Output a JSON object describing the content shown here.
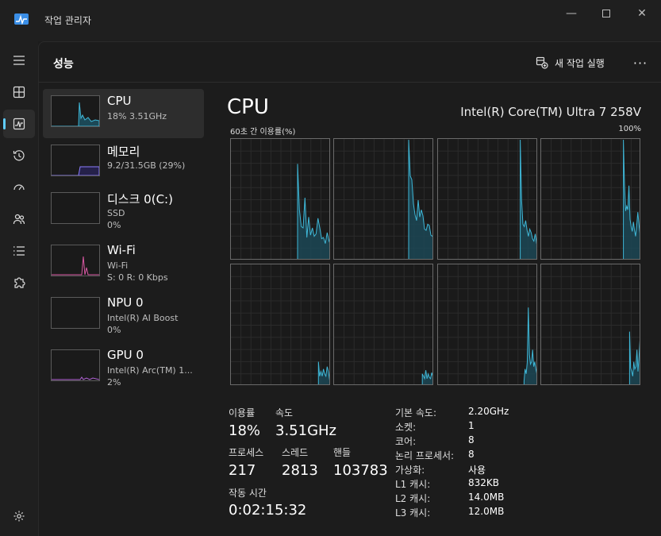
{
  "window": {
    "title": "작업 관리자"
  },
  "header": {
    "title": "성능",
    "new_task_label": "새 작업 실행",
    "more_label": "···"
  },
  "devices": [
    {
      "name": "CPU",
      "line1": "18% 3.51GHz",
      "line2": ""
    },
    {
      "name": "메모리",
      "line1": "9.2/31.5GB (29%)",
      "line2": ""
    },
    {
      "name": "디스크 0(C:)",
      "line1": "SSD",
      "line2": "0%"
    },
    {
      "name": "Wi-Fi",
      "line1": "Wi-Fi",
      "line2": "S: 0  R: 0 Kbps"
    },
    {
      "name": "NPU 0",
      "line1": "Intel(R) AI Boost",
      "line2": "0%"
    },
    {
      "name": "GPU 0",
      "line1": "Intel(R) Arc(TM) 1...",
      "line2": "2%"
    }
  ],
  "detail": {
    "title": "CPU",
    "model": "Intel(R) Core(TM) Ultra 7 258V",
    "graph_label_left": "60초 간 이용률(%)",
    "graph_label_right": "100%"
  },
  "stats": {
    "utilization_label": "이용률",
    "utilization_value": "18%",
    "speed_label": "속도",
    "speed_value": "3.51GHz",
    "processes_label": "프로세스",
    "processes_value": "217",
    "threads_label": "스레드",
    "threads_value": "2813",
    "handles_label": "핸들",
    "handles_value": "103783",
    "uptime_label": "작동 시간",
    "uptime_value": "0:02:15:32"
  },
  "specs": [
    {
      "key": "기본 속도:",
      "value": "2.20GHz"
    },
    {
      "key": "소켓:",
      "value": "1"
    },
    {
      "key": "코어:",
      "value": "8"
    },
    {
      "key": "논리 프로세서:",
      "value": "8"
    },
    {
      "key": "가상화:",
      "value": "사용"
    },
    {
      "key": "L1 캐시:",
      "value": "832KB"
    },
    {
      "key": "L2 캐시:",
      "value": "14.0MB"
    },
    {
      "key": "L3 캐시:",
      "value": "12.0MB"
    }
  ],
  "colors": {
    "cpu_line": "#3fb8d8",
    "cpu_fill": "#1c4856",
    "memory_line": "#8b7cff",
    "wifi_line": "#d958a4",
    "gpu_line": "#b163d6",
    "accent": "#60cdff"
  },
  "chart_data": {
    "type": "area",
    "y_range": [
      0,
      100
    ],
    "x_range_seconds": 60,
    "cores": [
      [
        0,
        0,
        0,
        0,
        0,
        0,
        0,
        0,
        0,
        0,
        0,
        0,
        0,
        0,
        0,
        0,
        0,
        0,
        0,
        0,
        0,
        0,
        0,
        0,
        0,
        0,
        0,
        0,
        0,
        0,
        0,
        0,
        0,
        0,
        0,
        0,
        80,
        42,
        28,
        27,
        52,
        19,
        36,
        21,
        27,
        20,
        22,
        35,
        27,
        18,
        19,
        14,
        23,
        16,
        20
      ],
      [
        0,
        0,
        0,
        0,
        0,
        0,
        0,
        0,
        0,
        0,
        0,
        0,
        0,
        0,
        0,
        0,
        0,
        0,
        0,
        0,
        0,
        0,
        0,
        0,
        0,
        0,
        0,
        0,
        0,
        0,
        0,
        0,
        0,
        0,
        0,
        0,
        0,
        0,
        0,
        0,
        0,
        0,
        0,
        0,
        0,
        0,
        0,
        100,
        70,
        67,
        47,
        38,
        33,
        50,
        36,
        42,
        37,
        26,
        25,
        30,
        29,
        21,
        20,
        24
      ],
      [
        0,
        0,
        0,
        0,
        0,
        0,
        0,
        0,
        0,
        0,
        0,
        0,
        0,
        0,
        0,
        0,
        0,
        0,
        0,
        0,
        0,
        0,
        0,
        0,
        0,
        0,
        0,
        0,
        0,
        0,
        0,
        0,
        0,
        0,
        0,
        0,
        0,
        0,
        0,
        0,
        0,
        0,
        0,
        0,
        0,
        0,
        0,
        0,
        0,
        0,
        0,
        0,
        0,
        0,
        0,
        0,
        0,
        0,
        0,
        0,
        100,
        50,
        30,
        28,
        33,
        25,
        20,
        26,
        23,
        18,
        16,
        22,
        14,
        13
      ],
      [
        0,
        0,
        0,
        0,
        0,
        0,
        0,
        0,
        0,
        0,
        0,
        0,
        0,
        0,
        0,
        0,
        0,
        0,
        0,
        0,
        0,
        0,
        0,
        0,
        0,
        0,
        0,
        0,
        0,
        0,
        0,
        0,
        0,
        0,
        0,
        0,
        0,
        0,
        0,
        0,
        0,
        0,
        0,
        0,
        0,
        0,
        0,
        0,
        0,
        0,
        0,
        0,
        0,
        0,
        0,
        0,
        0,
        0,
        0,
        0,
        0,
        0,
        0,
        0,
        0,
        0,
        0,
        0,
        0,
        0,
        0,
        0,
        0,
        0,
        100,
        63,
        41,
        45,
        42,
        62,
        34,
        28,
        24,
        32,
        25,
        20,
        29,
        40,
        30,
        22,
        28
      ],
      [
        0,
        0,
        0,
        0,
        0,
        0,
        0,
        0,
        0,
        0,
        0,
        0,
        0,
        0,
        0,
        0,
        0,
        0,
        0,
        0,
        0,
        0,
        0,
        0,
        0,
        0,
        0,
        0,
        0,
        0,
        0,
        0,
        0,
        0,
        0,
        0,
        0,
        0,
        0,
        0,
        0,
        0,
        0,
        0,
        0,
        0,
        0,
        0,
        0,
        0,
        0,
        0,
        0,
        0,
        0,
        0,
        0,
        0,
        0,
        0,
        0,
        0,
        0,
        0,
        0,
        0,
        0,
        0,
        0,
        0,
        20,
        8,
        12,
        8,
        14,
        10,
        8,
        16,
        12,
        5,
        6
      ],
      [
        0,
        0,
        0,
        0,
        0,
        0,
        0,
        0,
        0,
        0,
        0,
        0,
        0,
        0,
        0,
        0,
        0,
        0,
        0,
        0,
        0,
        0,
        0,
        0,
        0,
        0,
        0,
        0,
        0,
        0,
        0,
        0,
        0,
        0,
        0,
        0,
        0,
        0,
        0,
        0,
        0,
        0,
        0,
        0,
        0,
        0,
        0,
        0,
        0,
        0,
        0,
        0,
        0,
        0,
        0,
        0,
        0,
        0,
        0,
        0,
        0,
        0,
        0,
        0,
        0,
        0,
        0,
        0,
        0,
        0,
        0,
        0,
        0,
        0,
        0,
        10,
        8,
        6,
        13,
        6,
        10,
        7,
        6,
        11,
        8,
        5
      ],
      [
        0,
        0,
        0,
        0,
        0,
        0,
        0,
        0,
        0,
        0,
        0,
        0,
        0,
        0,
        0,
        0,
        0,
        0,
        0,
        0,
        0,
        0,
        0,
        0,
        0,
        0,
        0,
        0,
        0,
        0,
        0,
        0,
        0,
        0,
        0,
        0,
        0,
        0,
        0,
        0,
        0,
        0,
        0,
        0,
        0,
        0,
        0,
        0,
        0,
        0,
        0,
        0,
        0,
        0,
        0,
        0,
        0,
        0,
        0,
        0,
        0,
        0,
        0,
        0,
        0,
        0,
        0,
        0,
        0,
        0,
        0,
        0,
        0,
        0,
        0,
        0,
        0,
        0,
        0,
        0,
        4,
        14,
        10,
        20,
        65,
        26,
        18,
        20,
        30,
        16,
        20,
        14,
        10,
        6
      ],
      [
        0,
        0,
        0,
        0,
        0,
        0,
        0,
        0,
        0,
        0,
        0,
        0,
        0,
        0,
        0,
        0,
        0,
        0,
        0,
        0,
        0,
        0,
        0,
        0,
        0,
        0,
        0,
        0,
        0,
        0,
        0,
        0,
        0,
        0,
        0,
        0,
        0,
        0,
        0,
        0,
        0,
        0,
        0,
        0,
        0,
        0,
        0,
        0,
        0,
        0,
        0,
        0,
        0,
        0,
        0,
        0,
        0,
        0,
        0,
        0,
        0,
        0,
        0,
        0,
        0,
        0,
        0,
        0,
        0,
        0,
        0,
        0,
        0,
        0,
        0,
        0,
        0,
        0,
        0,
        0,
        0,
        0,
        0,
        0,
        45,
        15,
        12,
        8,
        20,
        14,
        16,
        30,
        12,
        24,
        40,
        8
      ]
    ]
  }
}
